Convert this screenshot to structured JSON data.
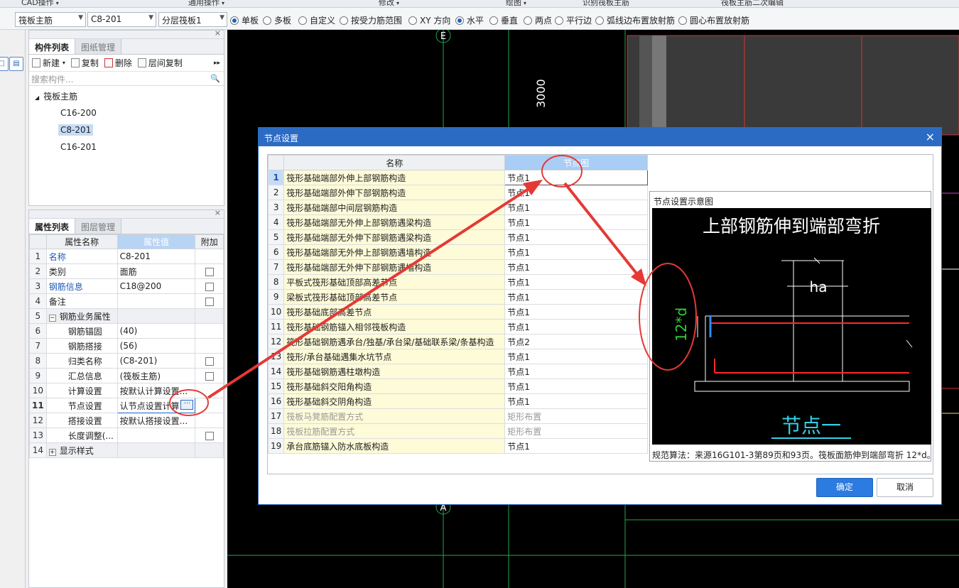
{
  "ribbon": {
    "groups": [
      "CAD操作",
      "通用操作",
      "修改",
      "绘图",
      "识别筏板主筋",
      "筏板主筋二次编辑"
    ]
  },
  "toolbar": {
    "combo_type": "筏板主筋",
    "combo_spec": "C8-201",
    "combo_layer": "分层筏板1",
    "radios": [
      {
        "label": "单板",
        "checked": true
      },
      {
        "label": "多板",
        "checked": false
      },
      {
        "label": "自定义",
        "checked": false
      },
      {
        "label": "按受力筋范围",
        "checked": false
      },
      {
        "label": "XY 方向",
        "checked": false
      },
      {
        "label": "水平",
        "checked": true
      },
      {
        "label": "垂直",
        "checked": false
      },
      {
        "label": "两点",
        "checked": false
      },
      {
        "label": "平行边",
        "checked": false
      },
      {
        "label": "弧线边布置放射筋",
        "checked": false
      },
      {
        "label": "圆心布置放射筋",
        "checked": false
      }
    ]
  },
  "component_panel": {
    "tabs": [
      "构件列表",
      "图纸管理"
    ],
    "actions": {
      "new": "新建",
      "copy": "复制",
      "delete": "删除",
      "floor_copy": "层间复制"
    },
    "search_placeholder": "搜索构件...",
    "tree_root": "筏板主筋",
    "tree_items": [
      "C16-200",
      "C8-201",
      "C16-201"
    ],
    "selected": "C8-201"
  },
  "property_panel": {
    "tabs": [
      "属性列表",
      "图层管理"
    ],
    "headers": {
      "name": "属性名称",
      "value": "属性值",
      "extra": "附加"
    },
    "rows": [
      {
        "no": "1",
        "name": "名称",
        "value": "C8-201",
        "blue": true,
        "check": false
      },
      {
        "no": "2",
        "name": "类别",
        "value": "面筋",
        "blue": false,
        "check": true
      },
      {
        "no": "3",
        "name": "钢筋信息",
        "value": "C18@200",
        "blue": true,
        "check": true
      },
      {
        "no": "4",
        "name": "备注",
        "value": "",
        "blue": false,
        "check": true
      },
      {
        "no": "5",
        "name": "钢筋业务属性",
        "value": "",
        "blue": false,
        "check": false,
        "group": "−"
      },
      {
        "no": "6",
        "name": "钢筋锚固",
        "value": "(40)",
        "blue": false,
        "check": false,
        "indent": true
      },
      {
        "no": "7",
        "name": "钢筋搭接",
        "value": "(56)",
        "blue": false,
        "check": false,
        "indent": true
      },
      {
        "no": "8",
        "name": "归类名称",
        "value": "(C8-201)",
        "blue": false,
        "check": true,
        "indent": true
      },
      {
        "no": "9",
        "name": "汇总信息",
        "value": "(筏板主筋)",
        "blue": false,
        "check": true,
        "indent": true
      },
      {
        "no": "10",
        "name": "计算设置",
        "value": "按默认计算设置...",
        "blue": false,
        "check": false,
        "indent": true
      },
      {
        "no": "11",
        "name": "节点设置",
        "value": "认节点设置计算",
        "blue": false,
        "check": false,
        "indent": true,
        "editing": true
      },
      {
        "no": "12",
        "name": "搭接设置",
        "value": "按默认搭接设置...",
        "blue": false,
        "check": false,
        "indent": true
      },
      {
        "no": "13",
        "name": "长度调整(...",
        "value": "",
        "blue": false,
        "check": true,
        "indent": true
      },
      {
        "no": "14",
        "name": "显示样式",
        "value": "",
        "blue": false,
        "check": false,
        "group": "+"
      }
    ],
    "ellipsis": "···"
  },
  "cad": {
    "axis_top": "E",
    "axis_bottom": "A",
    "dimension": "3000"
  },
  "dialog": {
    "title": "节点设置",
    "close": "×",
    "col_name": "名称",
    "col_node": "节点图",
    "rows": [
      {
        "no": "1",
        "name": "筏形基础端部外伸上部钢筋构造",
        "node": "节点1"
      },
      {
        "no": "2",
        "name": "筏形基础端部外伸下部钢筋构造",
        "node": "节点1"
      },
      {
        "no": "3",
        "name": "筏形基础端部中间层钢筋构造",
        "node": "节点1"
      },
      {
        "no": "4",
        "name": "筏形基础端部无外伸上部钢筋遇梁构造",
        "node": "节点1"
      },
      {
        "no": "5",
        "name": "筏形基础端部无外伸下部钢筋遇梁构造",
        "node": "节点1"
      },
      {
        "no": "6",
        "name": "筏形基础端部无外伸上部钢筋遇墙构造",
        "node": "节点1"
      },
      {
        "no": "7",
        "name": "筏形基础端部无外伸下部钢筋遇墙构造",
        "node": "节点1"
      },
      {
        "no": "8",
        "name": "平板式筏形基础顶部高差节点",
        "node": "节点1"
      },
      {
        "no": "9",
        "name": "梁板式筏形基础顶部高差节点",
        "node": "节点1"
      },
      {
        "no": "10",
        "name": "筏形基础底部高差节点",
        "node": "节点1"
      },
      {
        "no": "11",
        "name": "筏形基础钢筋锚入相邻筏板构造",
        "node": "节点1"
      },
      {
        "no": "12",
        "name": "筏形基础钢筋遇承台/独基/承台梁/基础联系梁/条基构造",
        "node": "节点2"
      },
      {
        "no": "13",
        "name": "筏形/承台基础遇集水坑节点",
        "node": "节点1"
      },
      {
        "no": "14",
        "name": "筏形基础钢筋遇柱墩构造",
        "node": "节点1"
      },
      {
        "no": "15",
        "name": "筏形基础斜交阳角构造",
        "node": "节点1"
      },
      {
        "no": "16",
        "name": "筏形基础斜交阴角构造",
        "node": "节点1"
      },
      {
        "no": "17",
        "name": "筏板马凳筋配置方式",
        "node": "矩形布置",
        "disabled": true
      },
      {
        "no": "18",
        "name": "筏板拉筋配置方式",
        "node": "矩形布置",
        "disabled": true
      },
      {
        "no": "19",
        "name": "承台底筋锚入防水底板构造",
        "node": "节点1"
      }
    ],
    "preview_title": "节点设置示意图",
    "preview_heading": "上部钢筋伸到端部弯折",
    "preview_ha": "ha",
    "preview_bend": "12*d",
    "preview_caption": "节点一",
    "note": "规范算法：来源16G101-3第89页和93页。筏板面筋伸到端部弯折 12*d。",
    "ok": "确定",
    "cancel": "取消"
  },
  "colors": {
    "accent": "#2b6bc4",
    "ok_button": "#2b7be0",
    "annotation_red": "#e53935",
    "name_cell_bg": "#fdfbd8"
  }
}
